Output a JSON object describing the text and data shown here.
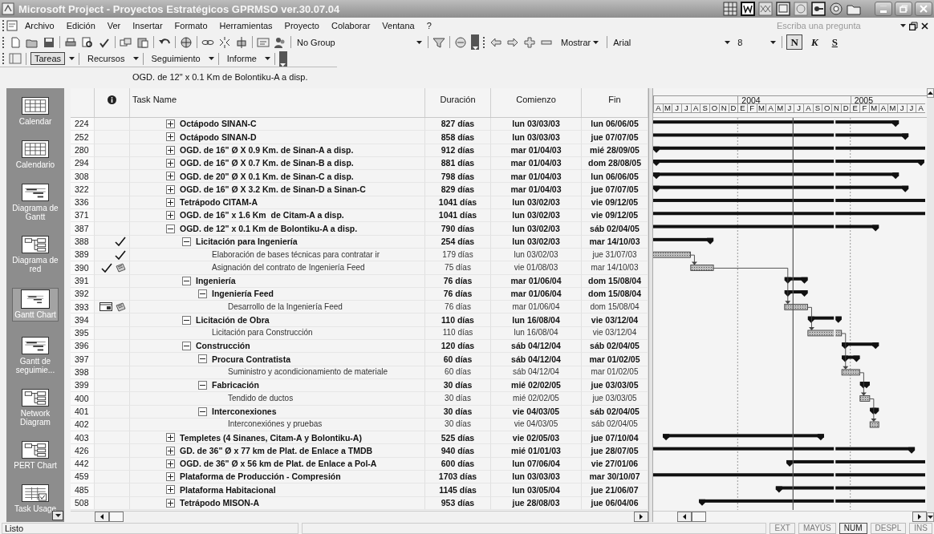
{
  "window": {
    "title": "Microsoft Project - Proyectos Estratégicos GPRMSO ver.30.07.04"
  },
  "menu": [
    "Archivo",
    "Edición",
    "Ver",
    "Insertar",
    "Formato",
    "Herramientas",
    "Proyecto",
    "Colaborar",
    "Ventana",
    "?"
  ],
  "help_search": {
    "placeholder": "Escriba una pregunta"
  },
  "standard_toolbar": {
    "group_by": "No Group"
  },
  "formatting_toolbar": {
    "show": "Mostrar",
    "font": "Arial",
    "size": "8",
    "styles": [
      {
        "label": "N",
        "kind": "bold",
        "pressed": true
      },
      {
        "label": "K",
        "kind": "italic",
        "pressed": false
      },
      {
        "label": "S",
        "kind": "underline",
        "pressed": false
      }
    ]
  },
  "guide_toolbar": [
    {
      "label": "Tareas",
      "pressed": true
    },
    {
      "label": "Recursos",
      "pressed": false
    },
    {
      "label": "Seguimiento",
      "pressed": false
    },
    {
      "label": "Informe",
      "pressed": false
    }
  ],
  "entry_bar": "OGD. de 12\" x 0.1 Km de Bolontiku-A a disp.",
  "view_bar": {
    "items": [
      {
        "label": "Calendar",
        "kind": "calendar",
        "selected": false
      },
      {
        "label": "Calendario",
        "kind": "calendar",
        "selected": false
      },
      {
        "label": "Diagrama de Gantt",
        "kind": "gantt",
        "selected": false
      },
      {
        "label": "Diagrama de red",
        "kind": "network",
        "selected": false
      },
      {
        "label": "Gantt Chart",
        "kind": "gantt",
        "selected": true
      },
      {
        "label": "Gantt de seguimie...",
        "kind": "gantt",
        "selected": false
      },
      {
        "label": "Network Diagram",
        "kind": "network",
        "selected": false
      },
      {
        "label": "PERT Chart",
        "kind": "network",
        "selected": false
      },
      {
        "label": "Task Usage",
        "kind": "usage",
        "selected": false
      }
    ]
  },
  "columns": [
    "Task Name",
    "Duración",
    "Comienzo",
    "Fin"
  ],
  "tasks": [
    {
      "id": "224",
      "name": "Octápodo SINAN-C",
      "kind": "summary",
      "expanded": false,
      "duration": "827 días",
      "start": "lun 03/03/03",
      "finish": "lun 06/06/05"
    },
    {
      "id": "252",
      "name": "Octápodo SINAN-D",
      "kind": "summary",
      "expanded": false,
      "duration": "858 días",
      "start": "lun 03/03/03",
      "finish": "jue 07/07/05"
    },
    {
      "id": "280",
      "name": "OGD. de 16\" Ø X 0.9 Km. de Sinan-A a disp.",
      "kind": "summary",
      "expanded": false,
      "duration": "912 días",
      "start": "mar 01/04/03",
      "finish": "mié 28/09/05"
    },
    {
      "id": "294",
      "name": "OGD. de 16\" Ø X 0.7 Km. de Sinan-B a disp.",
      "kind": "summary",
      "expanded": false,
      "duration": "881 días",
      "start": "mar 01/04/03",
      "finish": "dom 28/08/05"
    },
    {
      "id": "308",
      "name": "OGD. de 20\" Ø X 0.1 Km. de Sinan-C a disp.",
      "kind": "summary",
      "expanded": false,
      "duration": "798 días",
      "start": "mar 01/04/03",
      "finish": "lun 06/06/05"
    },
    {
      "id": "322",
      "name": "OGD. de 16\" Ø X 3.2 Km. de Sinan-D a Sinan-C",
      "kind": "summary",
      "expanded": false,
      "duration": "829 días",
      "start": "mar 01/04/03",
      "finish": "jue 07/07/05"
    },
    {
      "id": "336",
      "name": "Tetrápodo CITAM-A",
      "kind": "summary",
      "expanded": false,
      "duration": "1041 días",
      "start": "lun 03/02/03",
      "finish": "vie 09/12/05"
    },
    {
      "id": "371",
      "name": "OGD. de 16\" x 1.6 Km  de Citam-A a disp.",
      "kind": "summary",
      "expanded": false,
      "duration": "1041 días",
      "start": "lun 03/02/03",
      "finish": "vie 09/12/05"
    },
    {
      "id": "387",
      "name": "OGD. de 12\" x 0.1 Km de Bolontiku-A a disp.",
      "kind": "summary",
      "expanded": true,
      "duration": "790 días",
      "start": "lun 03/02/03",
      "finish": "sáb 02/04/05",
      "children": [
        {
          "id": "388",
          "name": "Licitación para Ingeniería",
          "kind": "summary",
          "expanded": true,
          "indicators": [
            {
              "kind": "complete"
            }
          ],
          "duration": "254 días",
          "start": "lun 03/02/03",
          "finish": "mar 14/10/03",
          "children": [
            {
              "id": "389",
              "name": "Elaboración de bases técnicas para contratar ir",
              "kind": "task",
              "indicators": [
                {
                  "kind": "complete"
                }
              ],
              "duration": "179 días",
              "start": "lun 03/02/03",
              "finish": "jue 31/07/03"
            },
            {
              "id": "390",
              "name": "Asignación del contrato de Ingeniería Feed",
              "kind": "task",
              "indicators": [
                {
                  "kind": "complete"
                },
                {
                  "kind": "note"
                }
              ],
              "duration": "75 días",
              "start": "vie 01/08/03",
              "finish": "mar 14/10/03"
            }
          ]
        },
        {
          "id": "391",
          "name": "Ingeniería",
          "kind": "summary",
          "expanded": true,
          "duration": "76 días",
          "start": "mar 01/06/04",
          "finish": "dom 15/08/04",
          "children": [
            {
              "id": "392",
              "name": "Ingeniería Feed",
              "kind": "summary",
              "expanded": true,
              "duration": "76 días",
              "start": "mar 01/06/04",
              "finish": "dom 15/08/04",
              "children": [
                {
                  "id": "393",
                  "name": "Desarrollo de la Ingeniería Feed",
                  "kind": "task",
                  "indicators": [
                    {
                      "kind": "calendar"
                    },
                    {
                      "kind": "note"
                    }
                  ],
                  "duration": "76 días",
                  "start": "mar 01/06/04",
                  "finish": "dom 15/08/04"
                }
              ]
            }
          ]
        },
        {
          "id": "394",
          "name": "Licitación de Obra",
          "kind": "summary",
          "expanded": true,
          "duration": "110 días",
          "start": "lun 16/08/04",
          "finish": "vie 03/12/04",
          "children": [
            {
              "id": "395",
              "name": "Licitación para Construcción",
              "kind": "task",
              "duration": "110 días",
              "start": "lun 16/08/04",
              "finish": "vie 03/12/04"
            }
          ]
        },
        {
          "id": "396",
          "name": "Construcción",
          "kind": "summary",
          "expanded": true,
          "duration": "120 días",
          "start": "sáb 04/12/04",
          "finish": "sáb 02/04/05",
          "children": [
            {
              "id": "397",
              "name": "Procura Contratista",
              "kind": "summary",
              "expanded": true,
              "duration": "60 días",
              "start": "sáb 04/12/04",
              "finish": "mar 01/02/05",
              "children": [
                {
                  "id": "398",
                  "name": "Suministro y acondicionamiento de materiale",
                  "kind": "task",
                  "duration": "60 días",
                  "start": "sáb 04/12/04",
                  "finish": "mar 01/02/05"
                }
              ]
            },
            {
              "id": "399",
              "name": "Fabricación",
              "kind": "summary",
              "expanded": true,
              "duration": "30 días",
              "start": "mié 02/02/05",
              "finish": "jue 03/03/05",
              "children": [
                {
                  "id": "400",
                  "name": "Tendido de ductos",
                  "kind": "task",
                  "duration": "30 días",
                  "start": "mié 02/02/05",
                  "finish": "jue 03/03/05"
                }
              ]
            },
            {
              "id": "401",
              "name": "Interconexiones",
              "kind": "summary",
              "expanded": true,
              "duration": "30 días",
              "start": "vie 04/03/05",
              "finish": "sáb 02/04/05",
              "children": [
                {
                  "id": "402",
                  "name": "Interconexiónes y pruebas",
                  "kind": "task",
                  "duration": "30 días",
                  "start": "vie 04/03/05",
                  "finish": "sáb 02/04/05"
                }
              ]
            }
          ]
        }
      ]
    },
    {
      "id": "403",
      "name": "Templetes (4 Sinanes, Citam-A y Bolontiku-A)",
      "kind": "summary",
      "expanded": false,
      "duration": "525 días",
      "start": "vie 02/05/03",
      "finish": "jue 07/10/04"
    },
    {
      "id": "426",
      "name": "GD. de 36\" Ø x 77 km de Plat. de Enlace a TMDB",
      "kind": "summary",
      "expanded": false,
      "duration": "940 días",
      "start": "mié 01/01/03",
      "finish": "jue 28/07/05"
    },
    {
      "id": "442",
      "name": "OGD. de 36\" Ø x 56 km de Plat. de Enlace a Pol-A",
      "kind": "summary",
      "expanded": false,
      "duration": "600 días",
      "start": "lun 07/06/04",
      "finish": "vie 27/01/06"
    },
    {
      "id": "459",
      "name": "Plataforma de Producción - Compresión",
      "kind": "summary",
      "expanded": false,
      "duration": "1703 días",
      "start": "lun 03/03/03",
      "finish": "mar 30/10/07"
    },
    {
      "id": "485",
      "name": "Plataforma Habitacional",
      "kind": "summary",
      "expanded": false,
      "duration": "1145 días",
      "start": "lun 03/05/04",
      "finish": "jue 21/06/07"
    },
    {
      "id": "508",
      "name": "Tetrápodo MISON-A",
      "kind": "summary",
      "expanded": false,
      "duration": "953 días",
      "start": "jue 28/08/03",
      "finish": "jue 06/04/06"
    }
  ],
  "timeline": [
    {
      "months": [
        "A",
        "M",
        "J",
        "J",
        "A",
        "S",
        "O",
        "N",
        "D"
      ]
    },
    {
      "label": "2004",
      "months": [
        "E",
        "F",
        "M",
        "A",
        "M",
        "J",
        "J",
        "A",
        "S",
        "O",
        "N",
        "D"
      ]
    },
    {
      "label": "2005",
      "months": [
        "E",
        "F",
        "M",
        "A",
        "M",
        "J",
        "J",
        "A"
      ]
    }
  ],
  "status_bar": {
    "text": "Listo",
    "indicators": [
      {
        "label": "EXT",
        "on": false
      },
      {
        "label": "MAYÚS",
        "on": false
      },
      {
        "label": "NUM",
        "on": true
      },
      {
        "label": "DESPL",
        "on": false
      },
      {
        "label": "INS",
        "on": false
      }
    ]
  }
}
